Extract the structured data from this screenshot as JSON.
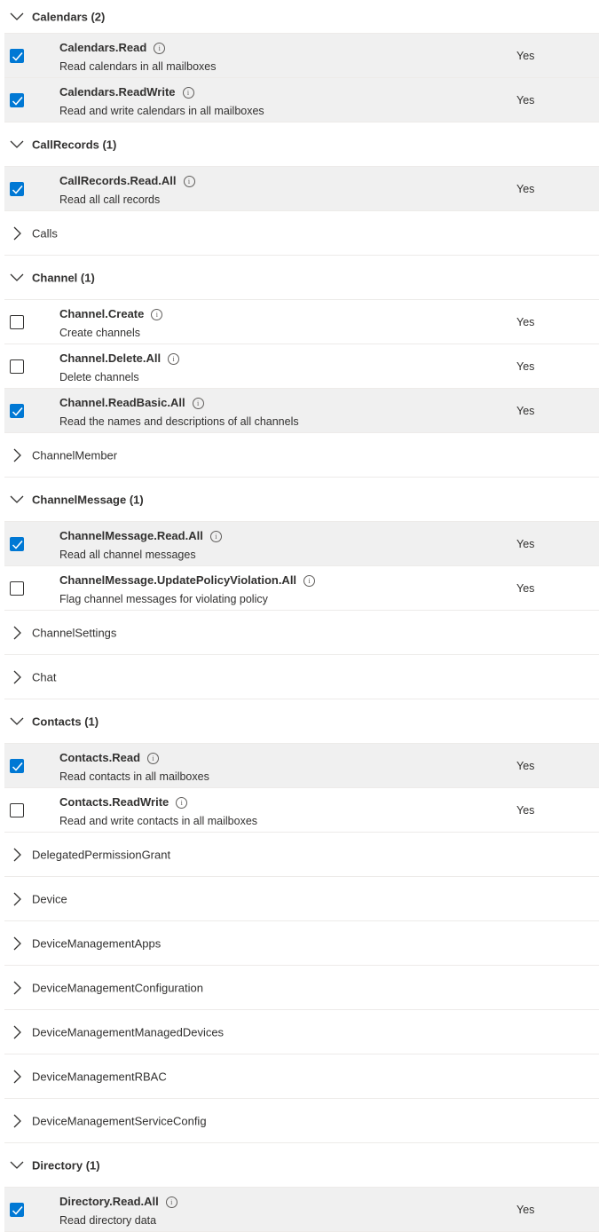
{
  "groups": [
    {
      "name": "Calendars (2)",
      "expanded": true,
      "permissions": [
        {
          "name": "Calendars.Read",
          "description": "Read calendars in all mailboxes",
          "admin_consent": "Yes",
          "checked": true
        },
        {
          "name": "Calendars.ReadWrite",
          "description": "Read and write calendars in all mailboxes",
          "admin_consent": "Yes",
          "checked": true
        }
      ]
    },
    {
      "name": "CallRecords (1)",
      "expanded": true,
      "permissions": [
        {
          "name": "CallRecords.Read.All",
          "description": "Read all call records",
          "admin_consent": "Yes",
          "checked": true
        }
      ]
    },
    {
      "name": "Calls",
      "expanded": false,
      "permissions": []
    },
    {
      "name": "Channel (1)",
      "expanded": true,
      "permissions": [
        {
          "name": "Channel.Create",
          "description": "Create channels",
          "admin_consent": "Yes",
          "checked": false
        },
        {
          "name": "Channel.Delete.All",
          "description": "Delete channels",
          "admin_consent": "Yes",
          "checked": false
        },
        {
          "name": "Channel.ReadBasic.All",
          "description": "Read the names and descriptions of all channels",
          "admin_consent": "Yes",
          "checked": true
        }
      ]
    },
    {
      "name": "ChannelMember",
      "expanded": false,
      "permissions": []
    },
    {
      "name": "ChannelMessage (1)",
      "expanded": true,
      "permissions": [
        {
          "name": "ChannelMessage.Read.All",
          "description": "Read all channel messages",
          "admin_consent": "Yes",
          "checked": true
        },
        {
          "name": "ChannelMessage.UpdatePolicyViolation.All",
          "description": "Flag channel messages for violating policy",
          "admin_consent": "Yes",
          "checked": false
        }
      ]
    },
    {
      "name": "ChannelSettings",
      "expanded": false,
      "permissions": []
    },
    {
      "name": "Chat",
      "expanded": false,
      "permissions": []
    },
    {
      "name": "Contacts (1)",
      "expanded": true,
      "permissions": [
        {
          "name": "Contacts.Read",
          "description": "Read contacts in all mailboxes",
          "admin_consent": "Yes",
          "checked": true
        },
        {
          "name": "Contacts.ReadWrite",
          "description": "Read and write contacts in all mailboxes",
          "admin_consent": "Yes",
          "checked": false
        }
      ]
    },
    {
      "name": "DelegatedPermissionGrant",
      "expanded": false,
      "permissions": []
    },
    {
      "name": "Device",
      "expanded": false,
      "permissions": []
    },
    {
      "name": "DeviceManagementApps",
      "expanded": false,
      "permissions": []
    },
    {
      "name": "DeviceManagementConfiguration",
      "expanded": false,
      "permissions": []
    },
    {
      "name": "DeviceManagementManagedDevices",
      "expanded": false,
      "permissions": []
    },
    {
      "name": "DeviceManagementRBAC",
      "expanded": false,
      "permissions": []
    },
    {
      "name": "DeviceManagementServiceConfig",
      "expanded": false,
      "permissions": []
    },
    {
      "name": "Directory (1)",
      "expanded": true,
      "permissions": [
        {
          "name": "Directory.Read.All",
          "description": "Read directory data",
          "admin_consent": "Yes",
          "checked": true
        }
      ]
    }
  ],
  "icons": {
    "expanded": "chevron-down-icon",
    "collapsed": "chevron-right-icon",
    "info": "info-icon",
    "check": "checkmark-icon"
  },
  "colors": {
    "accent": "#0078d4",
    "selected_row": "#f0f0f0",
    "divider": "#edebe9",
    "text": "#323130"
  }
}
